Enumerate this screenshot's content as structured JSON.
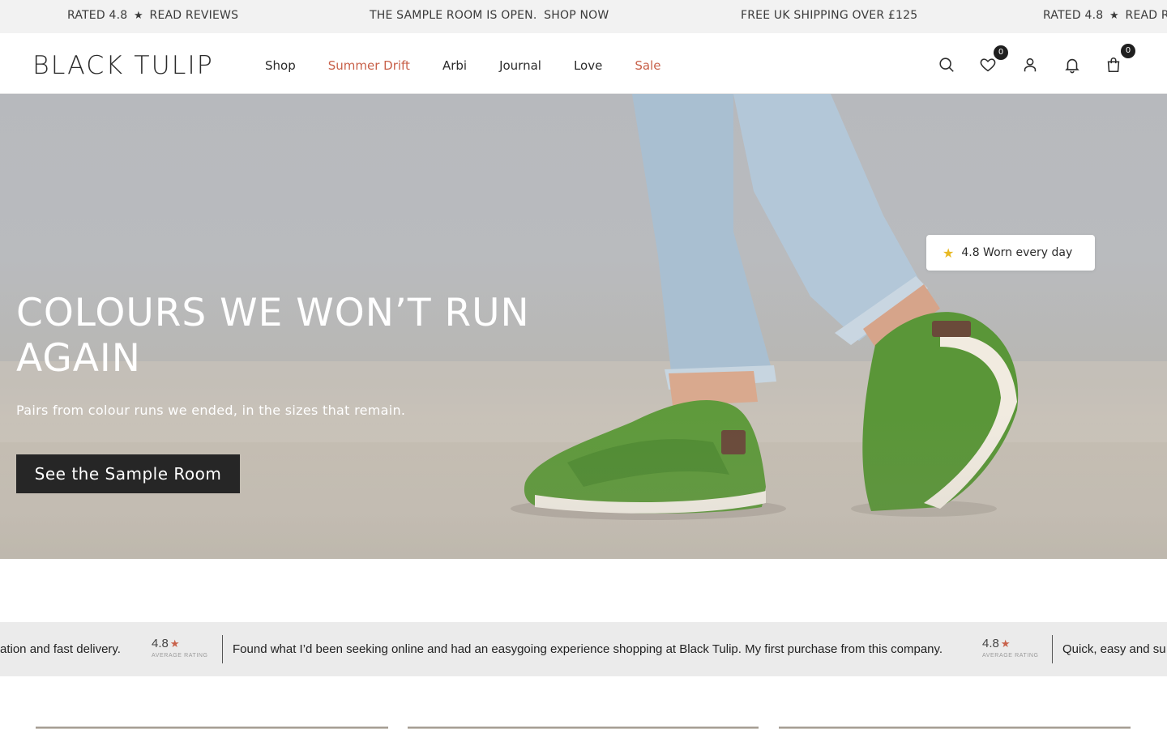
{
  "announcement": {
    "messages": [
      {
        "text": "RATED 4.8",
        "star": "★",
        "link": "READ REVIEWS"
      },
      {
        "text": "THE SAMPLE ROOM IS OPEN.",
        "link": "SHOP NOW"
      },
      {
        "text": "FREE UK SHIPPING OVER £125"
      },
      {
        "text": "RATED 4.8",
        "star": "★",
        "link": "READ RE"
      }
    ]
  },
  "header": {
    "logo": "BLACK TULIP",
    "nav": [
      {
        "label": "Shop",
        "highlight": false
      },
      {
        "label": "Summer Drift",
        "highlight": true
      },
      {
        "label": "Arbi",
        "highlight": false
      },
      {
        "label": "Journal",
        "highlight": false
      },
      {
        "label": "Love",
        "highlight": false
      },
      {
        "label": "Sale",
        "highlight": true
      }
    ],
    "icons": {
      "search": "search-icon",
      "wishlist": "heart-icon",
      "wishlist_count": "0",
      "account": "user-icon",
      "notifications": "bell-icon",
      "cart": "bag-icon",
      "cart_count": "0"
    },
    "highlight_color": "#c8614a"
  },
  "hero": {
    "title": "COLOURS WE WON’T RUN AGAIN",
    "subtitle": "Pairs from colour runs we ended, in the sizes that remain.",
    "cta": "See the Sample Room",
    "rating_pill": {
      "star": "★",
      "text": "4.8 Worn every day"
    }
  },
  "reviews_strip": {
    "items": [
      {
        "text": "ation and fast delivery."
      },
      {
        "score": "4.8",
        "star": "★",
        "caption": "AVERAGE RATING"
      },
      {
        "text": "Found what I’d been seeking online and had an easygoing experience shopping at Black Tulip. My first purchase from this company."
      },
      {
        "score": "4.8",
        "star": "★",
        "caption": "AVERAGE RATING"
      },
      {
        "text": "Quick, easy and su"
      }
    ]
  },
  "colors": {
    "accent": "#c8614a",
    "dark_button": "#262626",
    "star_gold": "#e8b923"
  }
}
